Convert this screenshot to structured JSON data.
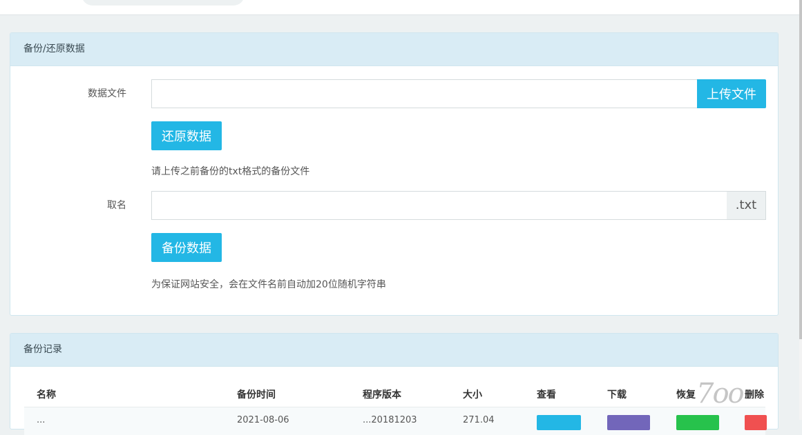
{
  "restore_panel": {
    "title": "备份/还原数据",
    "data_file_label": "数据文件",
    "upload_button": "上传文件",
    "restore_button": "还原数据",
    "restore_hint": "请上传之前备份的txt格式的备份文件",
    "name_label": "取名",
    "name_suffix": ".txt",
    "backup_button": "备份数据",
    "backup_hint": "为保证网站安全，会在文件名前自动加20位随机字符串"
  },
  "records_panel": {
    "title": "备份记录",
    "columns": [
      "名称",
      "备份时间",
      "程序版本",
      "大小",
      "查看",
      "下载",
      "恢复",
      "删除"
    ],
    "rows": [
      {
        "name": "...",
        "time": "2021-08-06",
        "version": "...20181203",
        "size": "271.04"
      }
    ]
  },
  "colors": {
    "primary": "#23b7e5",
    "purple": "#7266ba",
    "green": "#27c24c",
    "red": "#f05050",
    "panel_head": "#d9ecf5"
  },
  "watermark": {
    "text": "7oo"
  }
}
